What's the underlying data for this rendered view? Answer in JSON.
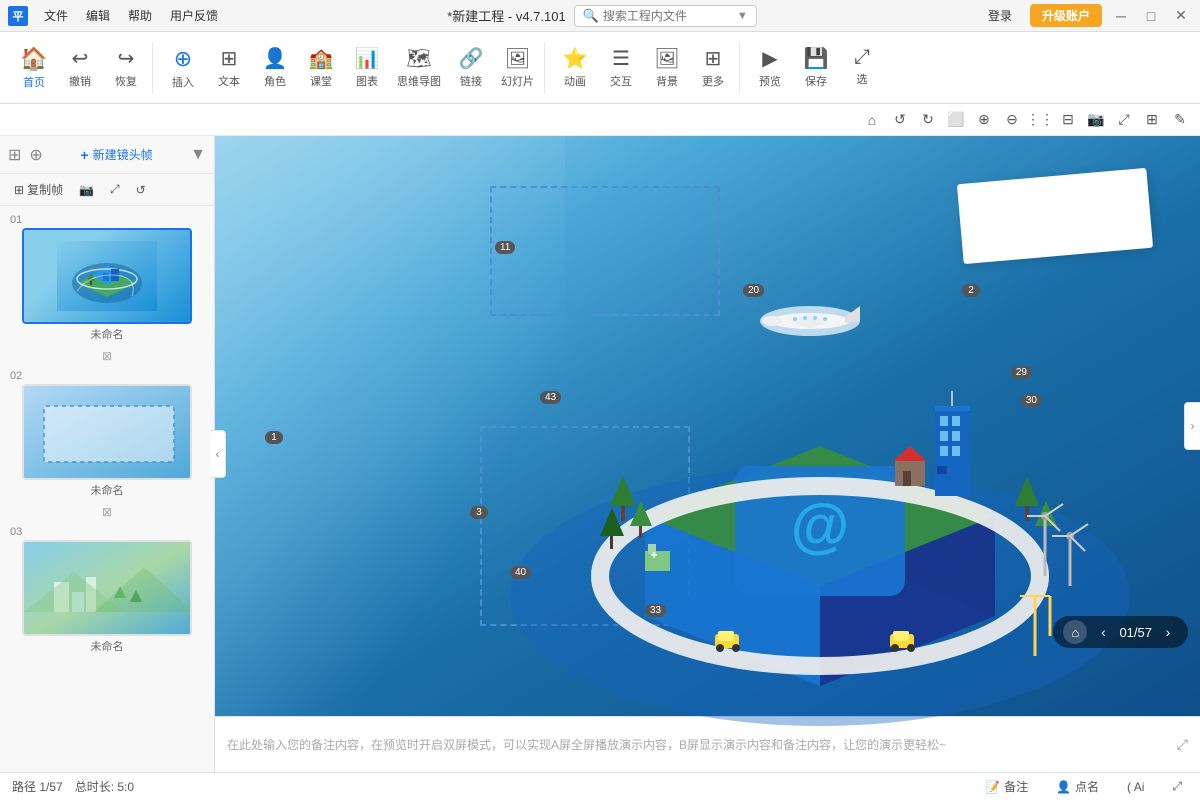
{
  "app": {
    "logo": "平",
    "title": "*新建工程 - v4.7.101",
    "search_placeholder": "搜索工程内文件"
  },
  "titlebar": {
    "menu_items": [
      "文件",
      "编辑",
      "帮助",
      "用户反馈"
    ],
    "login_label": "登录",
    "upgrade_label": "升级账户",
    "min_btn": "─",
    "max_btn": "□",
    "close_btn": "✕"
  },
  "toolbar": {
    "home_label": "首页",
    "undo_label": "撤销",
    "redo_label": "恢复",
    "insert_label": "插入",
    "text_label": "文本",
    "role_label": "角色",
    "class_label": "课堂",
    "chart_label": "图表",
    "mindmap_label": "思维导图",
    "link_label": "链接",
    "slide_label": "幻灯片",
    "animation_label": "动画",
    "interact_label": "交互",
    "bg_label": "背景",
    "more_label": "更多",
    "preview_label": "预览",
    "save_label": "保存",
    "select_label": "选"
  },
  "sidebar": {
    "add_frame_label": "新建镜头帧",
    "copy_frame_label": "复制帧",
    "slides": [
      {
        "number": "01",
        "label": "未命名",
        "active": true
      },
      {
        "number": "02",
        "label": "未命名",
        "active": false
      },
      {
        "number": "03",
        "label": "未命名",
        "active": false
      }
    ]
  },
  "canvas": {
    "notes_placeholder": "在此处输入您的备注内容，在预览时开启双屏模式，可以实现A屏全屏播放演示内容，B屏显示演示内容和备注内容，让您的演示更轻松~",
    "slide_counter": "01/57"
  },
  "statusbar": {
    "path": "路径 1/57",
    "duration": "总时长: 5:0",
    "notes_label": "备注",
    "bookmark_label": "点名",
    "ai_label": "( Ai"
  },
  "badges": [
    "11",
    "20",
    "2",
    "29",
    "30",
    "43",
    "3",
    "40",
    "33",
    "1"
  ],
  "action_icons": [
    "home",
    "rotate-left",
    "rotate-right",
    "copy",
    "zoom-in",
    "zoom-out",
    "align",
    "distribute",
    "camera",
    "expand",
    "grid",
    "edit"
  ],
  "colors": {
    "primary": "#1a73e8",
    "accent": "#f5a623",
    "bg_gradient_start": "#a8d8f0",
    "bg_gradient_end": "#0d4f8a"
  }
}
